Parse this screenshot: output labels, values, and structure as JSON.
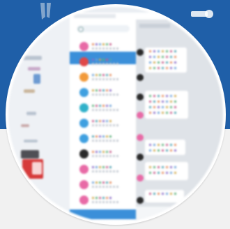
{
  "colors": {
    "banner": "#1f5fa8",
    "banner_dark": "#174c8a",
    "list_bg": "#ffffff",
    "chat_bg": "#dfe3e8",
    "selected": "#3b8fd9",
    "accent": "#2f86d6",
    "pink": "#e86aa6",
    "orange": "#f29a3a",
    "red": "#e04848"
  },
  "banner": {
    "icon_left": "person-silhouette-icon",
    "icon_right": "wrench-icon"
  },
  "window": {
    "title": ""
  },
  "contacts": [
    {
      "avatar_color": "#e86aa6",
      "icon": "heart-icon"
    },
    {
      "avatar_color": "#e04848",
      "icon": "dragon-icon"
    },
    {
      "avatar_color": "#f29a3a",
      "icon": "star-icon"
    },
    {
      "avatar_color": "#3fa0e0",
      "icon": "gear-icon"
    },
    {
      "avatar_color": "#2fb1c9",
      "icon": "cloud-icon"
    },
    {
      "avatar_color": "#3fa0e0",
      "icon": "gear-icon"
    },
    {
      "avatar_color": "#3fa0e0",
      "icon": "flower-icon"
    },
    {
      "avatar_color": "#2a2a2a",
      "icon": "bird-icon"
    },
    {
      "avatar_color": "#e86aa6",
      "icon": "heart-icon"
    },
    {
      "avatar_color": "#e86aa6",
      "icon": "heart-icon"
    },
    {
      "avatar_color": "#e86aa6",
      "icon": "heart-icon"
    }
  ]
}
